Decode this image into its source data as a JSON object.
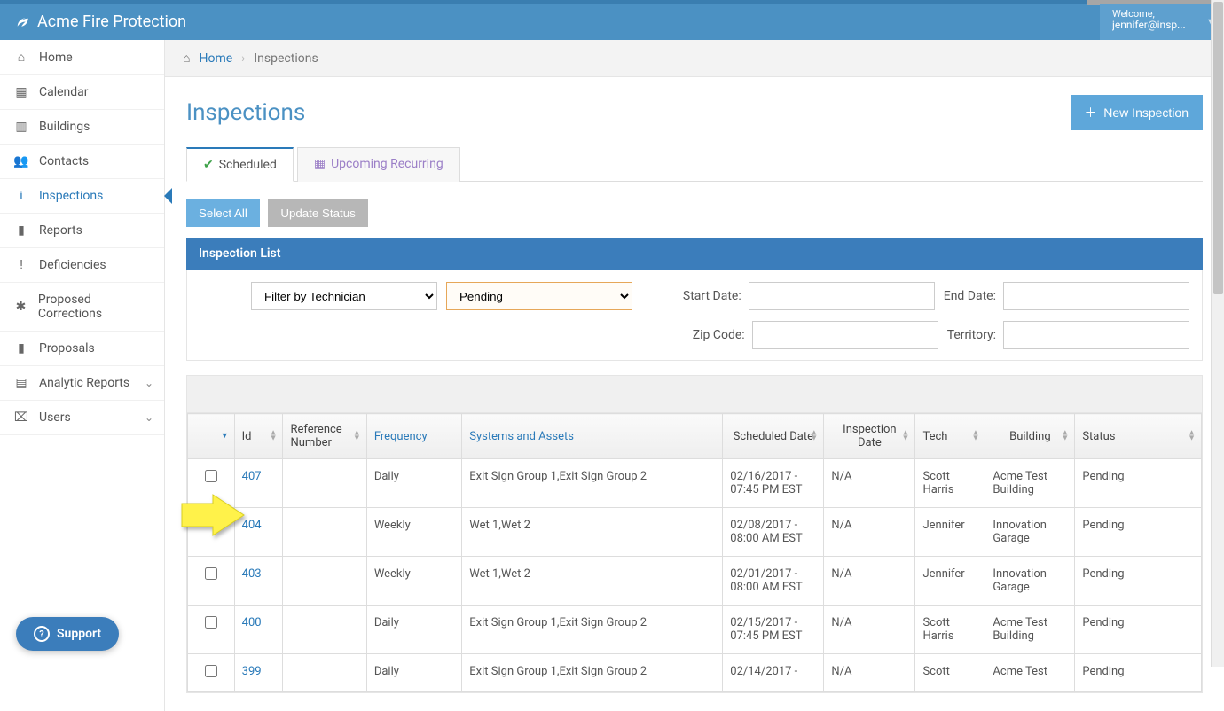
{
  "brand": "Acme Fire Protection",
  "user": {
    "welcome": "Welcome,",
    "email": "jennifer@insp..."
  },
  "sidebar": [
    {
      "label": "Home",
      "icon": "⌂"
    },
    {
      "label": "Calendar",
      "icon": "▦"
    },
    {
      "label": "Buildings",
      "icon": "▥"
    },
    {
      "label": "Contacts",
      "icon": "👥"
    },
    {
      "label": "Inspections",
      "icon": "i",
      "active": true
    },
    {
      "label": "Reports",
      "icon": "▮"
    },
    {
      "label": "Deficiencies",
      "icon": "!"
    },
    {
      "label": "Proposed Corrections",
      "icon": "✱"
    },
    {
      "label": "Proposals",
      "icon": "▮"
    },
    {
      "label": "Analytic Reports",
      "icon": "▤",
      "chev": true
    },
    {
      "label": "Users",
      "icon": "⌧",
      "chev": true
    }
  ],
  "breadcrumb": {
    "home": "Home",
    "current": "Inspections"
  },
  "page": {
    "title": "Inspections",
    "new_btn": "New Inspection"
  },
  "tabs": {
    "scheduled": "Scheduled",
    "upcoming": "Upcoming Recurring"
  },
  "toolbar": {
    "select_all": "Select All",
    "update_status": "Update Status"
  },
  "panel": {
    "title": "Inspection List"
  },
  "filters": {
    "technician": "Filter by Technician",
    "status": "Pending",
    "start_date_label": "Start Date:",
    "end_date_label": "End Date:",
    "zip_label": "Zip Code:",
    "territory_label": "Territory:"
  },
  "columns": {
    "id": "Id",
    "ref": "Reference Number",
    "freq": "Frequency",
    "sys": "Systems and Assets",
    "sched": "Scheduled Date",
    "idate": "Inspection Date",
    "tech": "Tech",
    "bldg": "Building",
    "stat": "Status"
  },
  "rows": [
    {
      "id": "407",
      "ref": "",
      "freq": "Daily",
      "sys": "Exit Sign Group 1,Exit Sign Group 2",
      "sched": "02/16/2017 - 07:45 PM EST",
      "idate": "N/A",
      "tech": "Scott Harris",
      "bldg": "Acme Test Building",
      "stat": "Pending"
    },
    {
      "id": "404",
      "ref": "",
      "freq": "Weekly",
      "sys": "Wet 1,Wet 2",
      "sched": "02/08/2017 - 08:00 AM EST",
      "idate": "N/A",
      "tech": "Jennifer",
      "bldg": "Innovation Garage",
      "stat": "Pending",
      "nocheck": true
    },
    {
      "id": "403",
      "ref": "",
      "freq": "Weekly",
      "sys": "Wet 1,Wet 2",
      "sched": "02/01/2017 - 08:00 AM EST",
      "idate": "N/A",
      "tech": "Jennifer",
      "bldg": "Innovation Garage",
      "stat": "Pending"
    },
    {
      "id": "400",
      "ref": "",
      "freq": "Daily",
      "sys": "Exit Sign Group 1,Exit Sign Group 2",
      "sched": "02/15/2017 - 07:45 PM EST",
      "idate": "N/A",
      "tech": "Scott Harris",
      "bldg": "Acme Test Building",
      "stat": "Pending"
    },
    {
      "id": "399",
      "ref": "",
      "freq": "Daily",
      "sys": "Exit Sign Group 1,Exit Sign Group 2",
      "sched": "02/14/2017 -",
      "idate": "N/A",
      "tech": "Scott",
      "bldg": "Acme Test",
      "stat": "Pending"
    }
  ],
  "support": "Support"
}
